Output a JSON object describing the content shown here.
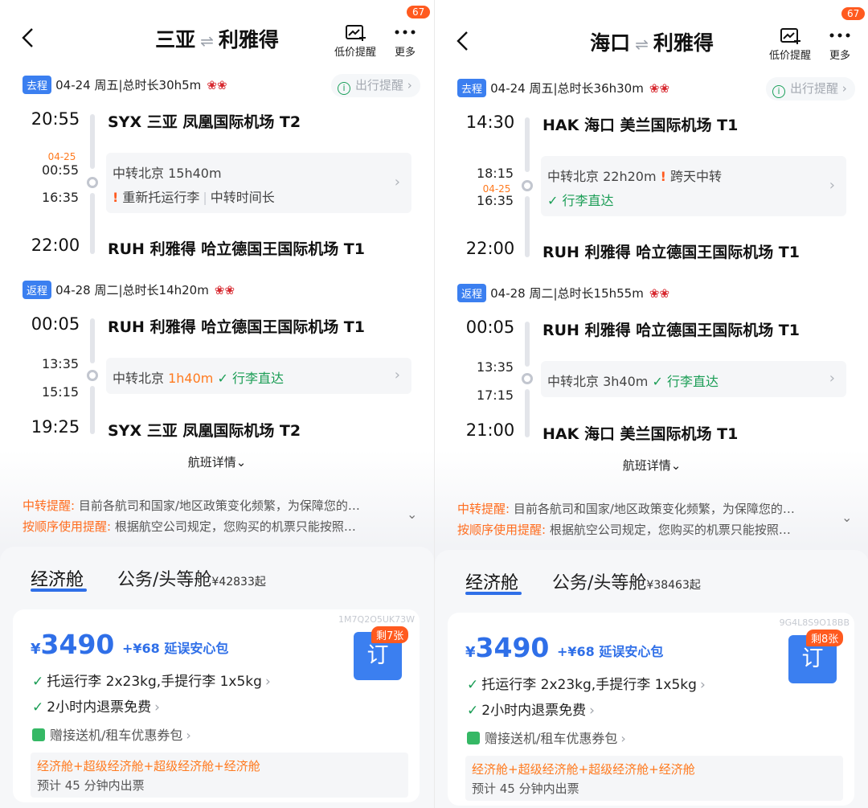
{
  "screens": [
    {
      "header": {
        "origin": "三亚",
        "destination": "利雅得",
        "separator": "⇌",
        "price_alert_label": "低价提醒",
        "more_label": "更多",
        "more_badge": "67"
      },
      "outbound": {
        "tag": "去程",
        "date": "04-24 周五",
        "duration": "总时长30h5m",
        "reminder": "出行提醒",
        "dep_time": "20:55",
        "dep_airport": "SYX  三亚 凤凰国际机场 T2",
        "conn_arr_date": "04-25",
        "conn_arr_time": "00:55",
        "conn_dep_date": "",
        "conn_dep_time": "16:35",
        "transfer_label": "中转北京 15h40m",
        "transfer_duration": "",
        "transfer_extra": "",
        "transfer_line2_a": "重新托运行李",
        "transfer_line2_b": "中转时间长",
        "arr_time": "22:00",
        "arr_airport": "RUH  利雅得 哈立德国王国际机场 T1"
      },
      "return": {
        "tag": "返程",
        "date": "04-28 周二",
        "duration": "总时长14h20m",
        "dep_time": "00:05",
        "dep_airport": "RUH  利雅得 哈立德国王国际机场 T1",
        "conn_arr_time": "13:35",
        "conn_dep_time": "15:15",
        "transfer_label": "中转北京 ",
        "transfer_duration": "1h40m",
        "transfer_extra": "行李直达",
        "arr_time": "19:25",
        "arr_airport": "SYX  三亚 凤凰国际机场 T2"
      },
      "flight_details": "航班详情",
      "notice": {
        "l1_key": "中转提醒:",
        "l1_text": " 目前各航司和国家/地区政策变化频繁，为保障您的…",
        "l2_key": "按顺序使用提醒:",
        "l2_text": " 根据航空公司规定，您购买的机票只能按照…"
      },
      "tabs": {
        "economy": "经济舱",
        "business": "公务/头等舱",
        "business_price": "¥42833起"
      },
      "card": {
        "code": "1M7Q2O5UK73W",
        "currency": "¥",
        "price": "3490",
        "addon": "+¥68 延误安心包",
        "book_label": "订",
        "left_badge": "剩7张",
        "perk1": "托运行李 2x23kg,手提行李 1x5kg",
        "perk2": "2小时内退票免费",
        "gift": "赠接送机/租车优惠券包",
        "note_cabins": "经济舱+超级经济舱+超级经济舱+经济舱",
        "note_time": "预计 45 分钟内出票"
      }
    },
    {
      "header": {
        "origin": "海口",
        "destination": "利雅得",
        "separator": "⇌",
        "price_alert_label": "低价提醒",
        "more_label": "更多",
        "more_badge": "67"
      },
      "outbound": {
        "tag": "去程",
        "date": "04-24 周五",
        "duration": "总时长36h30m",
        "reminder": "出行提醒",
        "dep_time": "14:30",
        "dep_airport": "HAK  海口 美兰国际机场 T1",
        "conn_arr_date": "",
        "conn_arr_time": "18:15",
        "conn_dep_date": "04-25",
        "conn_dep_time": "16:35",
        "transfer_label": "中转北京 22h20m",
        "transfer_duration": "",
        "transfer_extra": "跨天中转",
        "transfer_line2_a": "行李直达",
        "transfer_line2_b": "",
        "arr_time": "22:00",
        "arr_airport": "RUH  利雅得 哈立德国王国际机场 T1"
      },
      "return": {
        "tag": "返程",
        "date": "04-28 周二",
        "duration": "总时长15h55m",
        "dep_time": "00:05",
        "dep_airport": "RUH  利雅得 哈立德国王国际机场 T1",
        "conn_arr_time": "13:35",
        "conn_dep_time": "17:15",
        "transfer_label": "中转北京 3h40m",
        "transfer_duration": "",
        "transfer_extra": "行李直达",
        "arr_time": "21:00",
        "arr_airport": "HAK  海口 美兰国际机场 T1"
      },
      "flight_details": "航班详情",
      "notice": {
        "l1_key": "中转提醒:",
        "l1_text": " 目前各航司和国家/地区政策变化频繁，为保障您的…",
        "l2_key": "按顺序使用提醒:",
        "l2_text": " 根据航空公司规定，您购买的机票只能按照…"
      },
      "tabs": {
        "economy": "经济舱",
        "business": "公务/头等舱",
        "business_price": "¥38463起"
      },
      "card": {
        "code": "9G4L8S9O18BB",
        "currency": "¥",
        "price": "3490",
        "addon": "+¥68 延误安心包",
        "book_label": "订",
        "left_badge": "剩8张",
        "perk1": "托运行李 2x23kg,手提行李 1x5kg",
        "perk2": "2小时内退票免费",
        "gift": "赠接送机/租车优惠券包",
        "note_cabins": "经济舱+超级经济舱+超级经济舱+经济舱",
        "note_time": "预计 45 分钟内出票"
      }
    }
  ],
  "colors": {
    "accent_blue": "#2f6fe8",
    "tag_blue": "#3b7ff0",
    "orange": "#ff7a1f",
    "green": "#1a9d55",
    "badge_red": "#ff5a1f",
    "airline_red": "#d7282f"
  },
  "icons": [
    "back-arrow-icon",
    "price-alert-chart-icon",
    "more-dots-icon",
    "info-circle-icon",
    "airline-logo-icon",
    "warning-icon",
    "check-icon",
    "chevron-right-icon",
    "chevron-down-icon",
    "gift-icon"
  ]
}
